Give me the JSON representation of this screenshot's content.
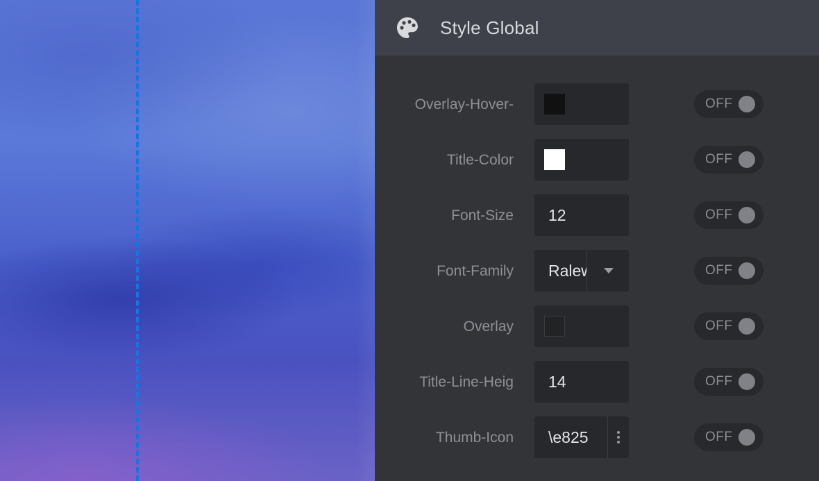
{
  "panel": {
    "title": "Style Global",
    "icon": "palette-icon"
  },
  "colors": {
    "guide_line": "#1b73e0",
    "panel_bg": "#333438",
    "header_bg": "#3e4149"
  },
  "rows": [
    {
      "label": "Overlay-Hover-",
      "type": "color",
      "swatch": "#111111",
      "toggle": "OFF"
    },
    {
      "label": "Title-Color",
      "type": "color",
      "swatch": "#ffffff",
      "toggle": "OFF"
    },
    {
      "label": "Font-Size",
      "type": "text",
      "value": "12",
      "toggle": "OFF"
    },
    {
      "label": "Font-Family",
      "type": "select",
      "value": "Ralew",
      "toggle": "OFF"
    },
    {
      "label": "Overlay",
      "type": "color",
      "swatch": "#222325",
      "toggle": "OFF"
    },
    {
      "label": "Title-Line-Heig",
      "type": "text",
      "value": "14",
      "toggle": "OFF"
    },
    {
      "label": "Thumb-Icon",
      "type": "icon-picker",
      "value": "\\e825",
      "toggle": "OFF"
    }
  ]
}
